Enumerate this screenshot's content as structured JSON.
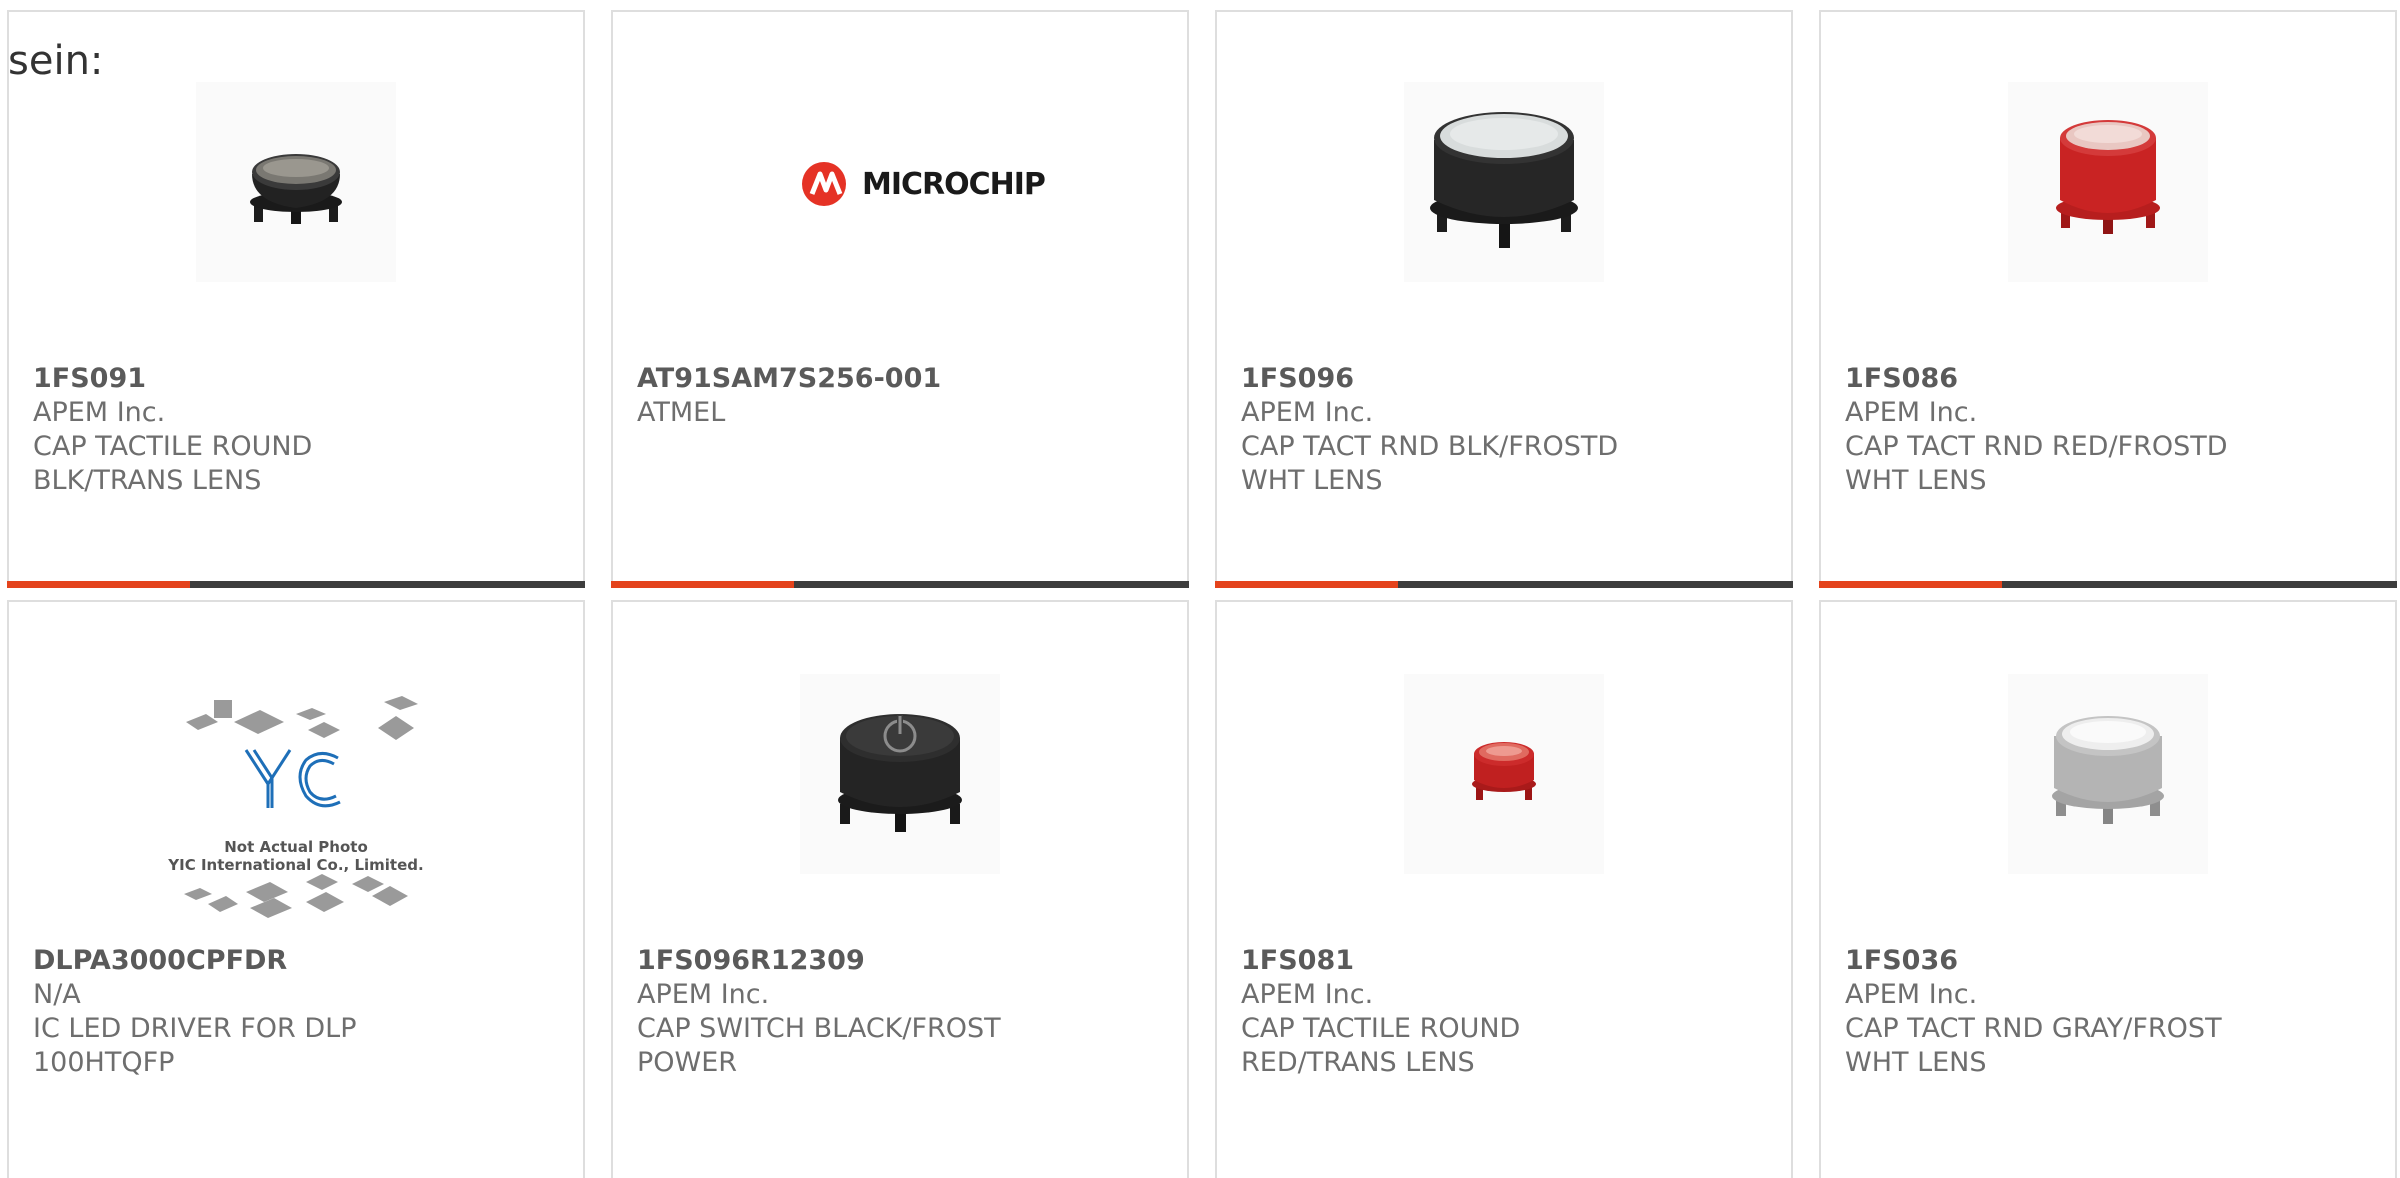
{
  "lead_text": "sein:",
  "colors": {
    "accent": "#e4431c",
    "bar": "#3d3d3d",
    "border": "#dedede"
  },
  "products": [
    {
      "part": "1FS091",
      "manufacturer": "APEM Inc.",
      "description": "CAP TACTILE ROUND BLK/TRANS LENS",
      "image": "black-transparent-cap"
    },
    {
      "part": "AT91SAM7S256-001",
      "manufacturer": "ATMEL",
      "description": "",
      "image": "microchip-logo",
      "logo_text": "MICROCHIP"
    },
    {
      "part": "1FS096",
      "manufacturer": "APEM Inc.",
      "description": "CAP TACT RND BLK/FROSTD WHT LENS",
      "image": "black-white-cap"
    },
    {
      "part": "1FS086",
      "manufacturer": "APEM Inc.",
      "description": "CAP TACT RND RED/FROSTD WHT LENS",
      "image": "red-white-cap"
    },
    {
      "part": "DLPA3000CPFDR",
      "manufacturer": "N/A",
      "description": "IC LED DRIVER FOR DLP 100HTQFP",
      "image": "not-actual-photo",
      "photo_caption_1": "Not Actual Photo",
      "photo_caption_2": "YIC International Co., Limited.",
      "logo_text": "YIC"
    },
    {
      "part": "1FS096R12309",
      "manufacturer": "APEM Inc.",
      "description": "CAP SWITCH BLACK/FROST POWER",
      "image": "black-power-cap"
    },
    {
      "part": "1FS081",
      "manufacturer": "APEM Inc.",
      "description": "CAP TACTILE ROUND RED/TRANS LENS",
      "image": "red-transparent-cap"
    },
    {
      "part": "1FS036",
      "manufacturer": "APEM Inc.",
      "description": "CAP TACT RND GRAY/FROST WHT LENS",
      "image": "gray-white-cap"
    }
  ]
}
